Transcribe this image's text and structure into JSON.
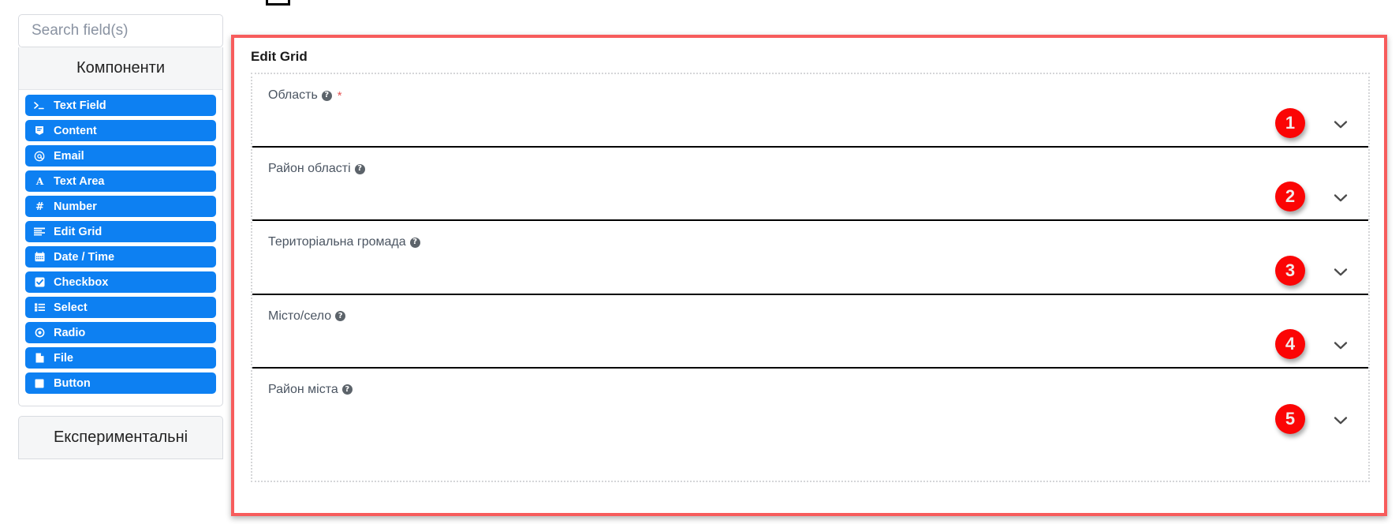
{
  "sidebar": {
    "search": {
      "placeholder": "Search field(s)",
      "value": ""
    },
    "panel_title": "Компоненти",
    "components": [
      {
        "label": "Text Field",
        "icon": "terminal-prompt-icon"
      },
      {
        "label": "Content",
        "icon": "content-block-icon"
      },
      {
        "label": "Email",
        "icon": "at-sign-icon"
      },
      {
        "label": "Text Area",
        "icon": "letter-a-icon"
      },
      {
        "label": "Number",
        "icon": "hash-icon"
      },
      {
        "label": "Edit Grid",
        "icon": "grid-rows-icon"
      },
      {
        "label": "Date / Time",
        "icon": "calendar-icon"
      },
      {
        "label": "Checkbox",
        "icon": "checkbox-icon"
      },
      {
        "label": "Select",
        "icon": "list-select-icon"
      },
      {
        "label": "Radio",
        "icon": "radio-dot-icon"
      },
      {
        "label": "File",
        "icon": "file-icon"
      },
      {
        "label": "Button",
        "icon": "square-button-icon"
      }
    ],
    "panel2_title": "Експериментальні"
  },
  "edit_grid": {
    "title": "Edit Grid",
    "fields": [
      {
        "label": "Область",
        "required": true,
        "badge": "1",
        "help": "?"
      },
      {
        "label": "Район області",
        "required": false,
        "badge": "2",
        "help": "?"
      },
      {
        "label": "Територіальна громада",
        "required": false,
        "badge": "3",
        "help": "?"
      },
      {
        "label": "Місто/село",
        "required": false,
        "badge": "4",
        "help": "?"
      },
      {
        "label": "Район міста",
        "required": false,
        "badge": "5",
        "help": "?"
      }
    ]
  },
  "colors": {
    "accent_blue": "#0d80f2",
    "badge_red": "#fb0505",
    "border_red": "#f75c5c",
    "required_red": "#e55353"
  }
}
